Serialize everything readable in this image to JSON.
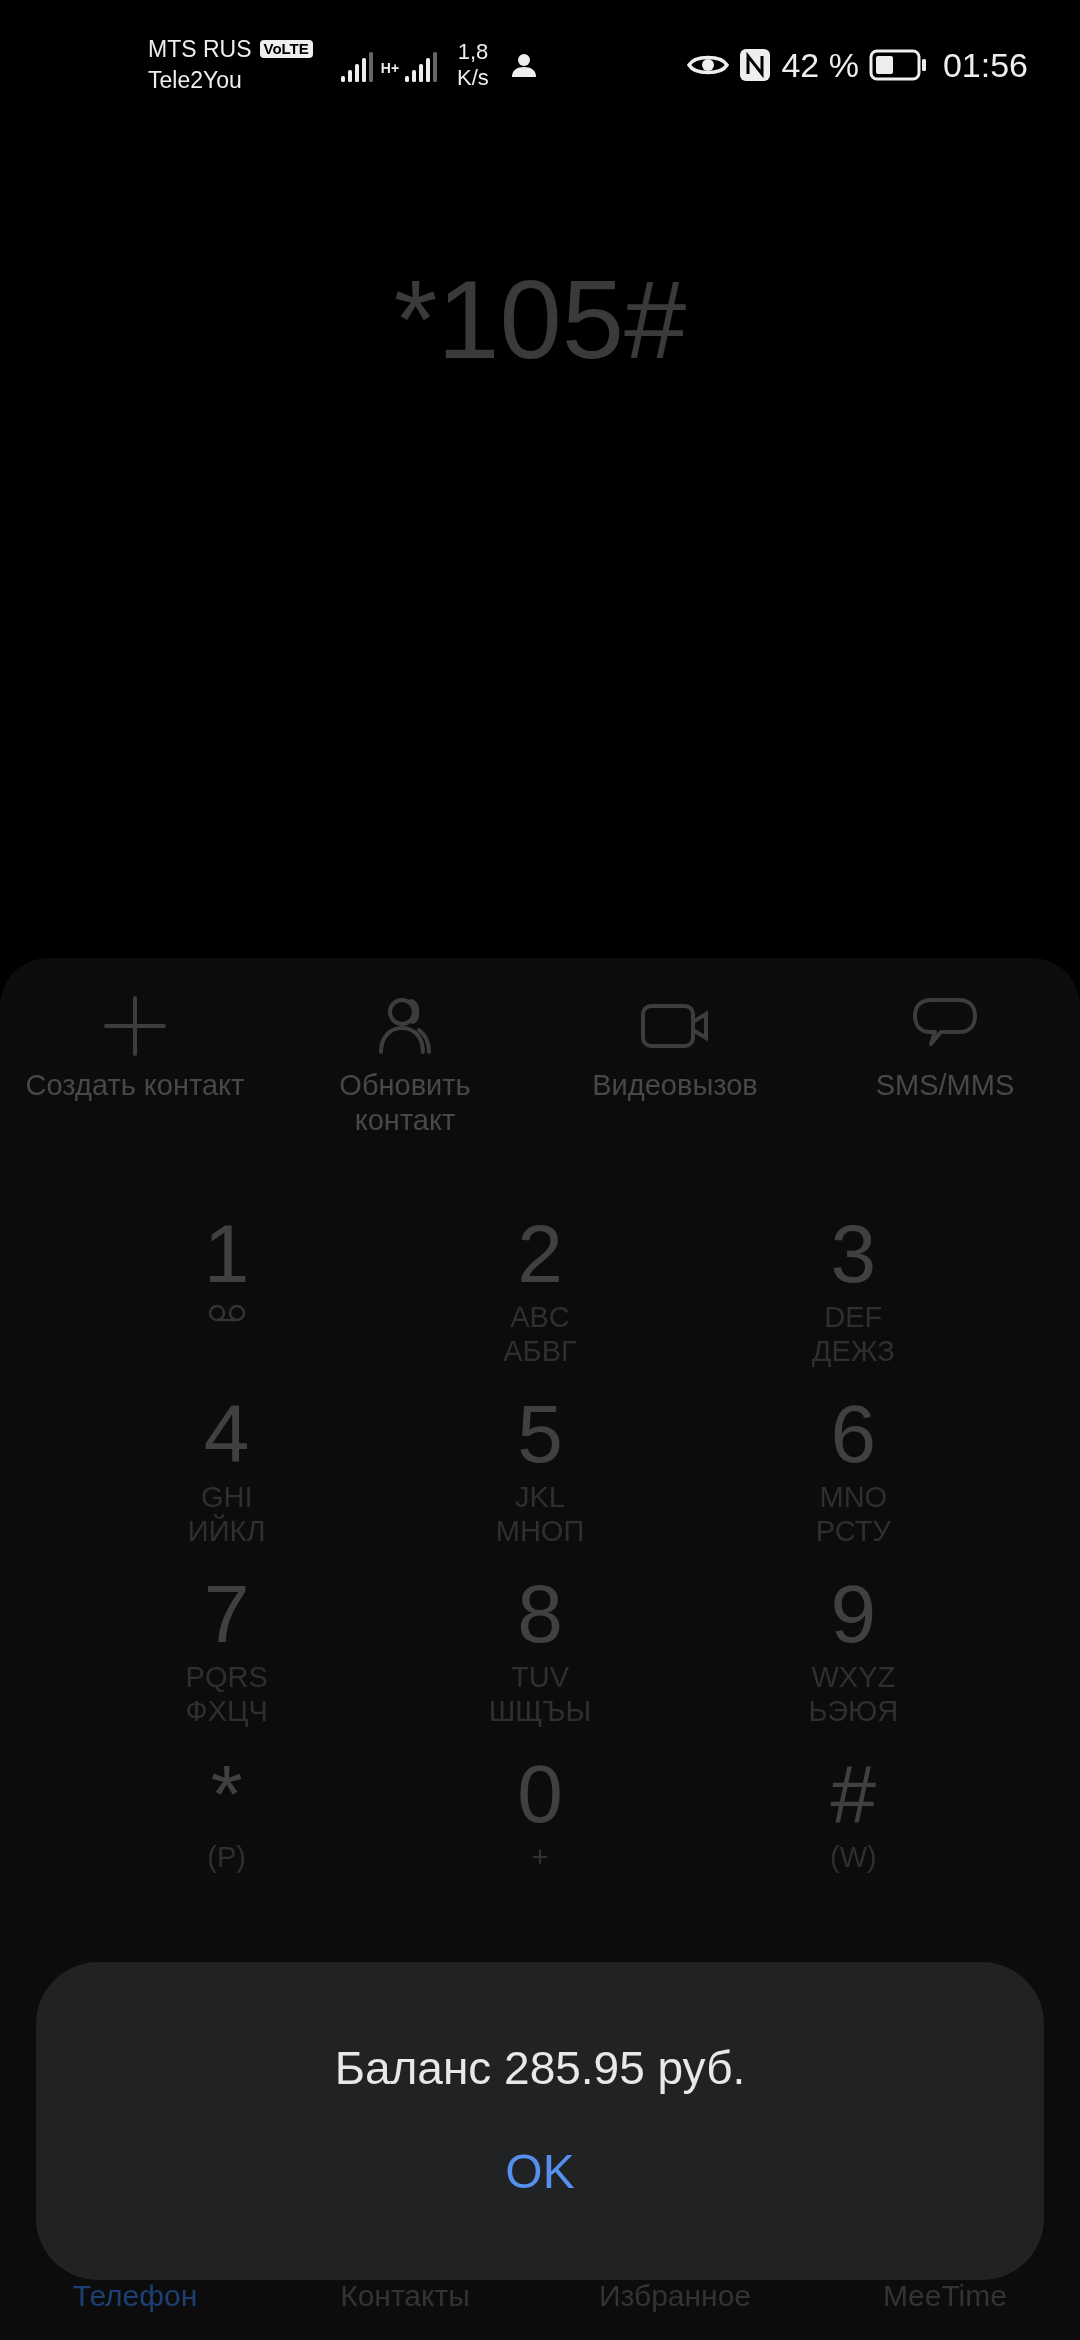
{
  "status_bar": {
    "carrier_1": "MTS RUS",
    "volte_badge": "VoLTE",
    "carrier_2": "Tele2You",
    "network_type": "H+",
    "speed_value": "1,8",
    "speed_unit": "K/s",
    "battery_percent": "42 %",
    "time": "01:56"
  },
  "dialed_number": "*105#",
  "actions": [
    {
      "kind": "add",
      "label": "Создать контакт"
    },
    {
      "kind": "person",
      "label": "Обновить контакт"
    },
    {
      "kind": "video",
      "label": "Видеовызов"
    },
    {
      "kind": "message",
      "label": "SMS/MMS"
    }
  ],
  "keys": [
    {
      "digit": "1",
      "kind": "voicemail"
    },
    {
      "digit": "2",
      "kind": "letters",
      "letters": [
        "ABC",
        "АБВГ"
      ]
    },
    {
      "digit": "3",
      "kind": "letters",
      "letters": [
        "DEF",
        "ДЕЖЗ"
      ]
    },
    {
      "digit": "4",
      "kind": "letters",
      "letters": [
        "GHI",
        "ИЙКЛ"
      ]
    },
    {
      "digit": "5",
      "kind": "letters",
      "letters": [
        "JKL",
        "МНОП"
      ]
    },
    {
      "digit": "6",
      "kind": "letters",
      "letters": [
        "MNO",
        "РСТУ"
      ]
    },
    {
      "digit": "7",
      "kind": "letters",
      "letters": [
        "PQRS",
        "ФХЦЧ"
      ]
    },
    {
      "digit": "8",
      "kind": "letters",
      "letters": [
        "TUV",
        "ШЩЪЫ"
      ]
    },
    {
      "digit": "9",
      "kind": "letters",
      "letters": [
        "WXYZ",
        "ЬЭЮЯ"
      ]
    },
    {
      "digit": "*",
      "kind": "letters",
      "letters": [
        "(P)"
      ]
    },
    {
      "digit": "0",
      "kind": "letters",
      "letters": [
        "+"
      ]
    },
    {
      "digit": "#",
      "kind": "letters",
      "letters": [
        "(W)"
      ]
    }
  ],
  "tabs": [
    {
      "label": "Телефон",
      "selected": true
    },
    {
      "label": "Контакты",
      "selected": false
    },
    {
      "label": "Избранное",
      "selected": false
    },
    {
      "label": "MeeTime",
      "selected": false
    }
  ],
  "dialog": {
    "message": "Баланс 285.95 руб.",
    "button": "OK"
  }
}
